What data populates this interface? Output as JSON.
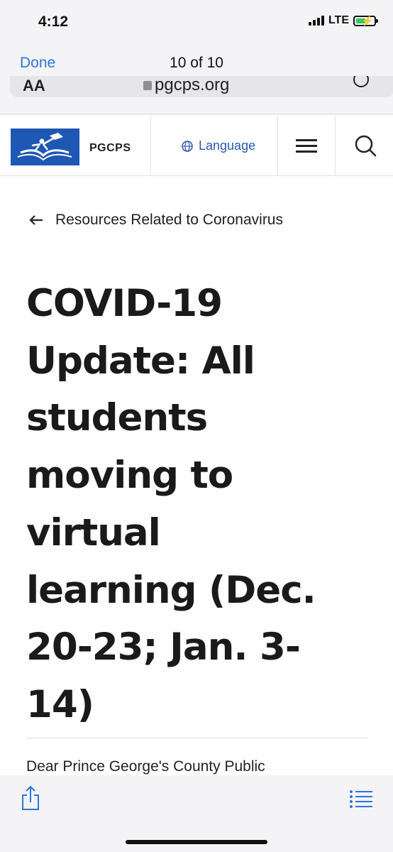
{
  "status_bar": {
    "time": "4:12",
    "network": "LTE",
    "battery_charging": true
  },
  "nav": {
    "done_label": "Done",
    "counter": "10 of 10"
  },
  "address_bar": {
    "aa_label": "AA",
    "url": "pgcps.org"
  },
  "site_header": {
    "brand": "PGCPS",
    "language_label": "Language"
  },
  "article": {
    "back_label": "Resources Related to Coronavirus",
    "headline_lines": [
      "COVID-19",
      "Update: All",
      "students",
      "moving to",
      "virtual",
      "learning (Dec.",
      "20-23; Jan. 3-",
      "14)"
    ],
    "body_start": "Dear Prince George's County Public"
  },
  "colors": {
    "link": "#2a76de",
    "brand_blue": "#1f57b4",
    "language_blue": "#2b57b3",
    "battery_green": "#34c759"
  },
  "icons": [
    "signal-icon",
    "battery-icon",
    "lock-icon",
    "reload-icon",
    "logo-icon",
    "globe-icon",
    "menu-icon",
    "search-icon",
    "back-arrow-icon",
    "share-icon",
    "list-icon"
  ]
}
